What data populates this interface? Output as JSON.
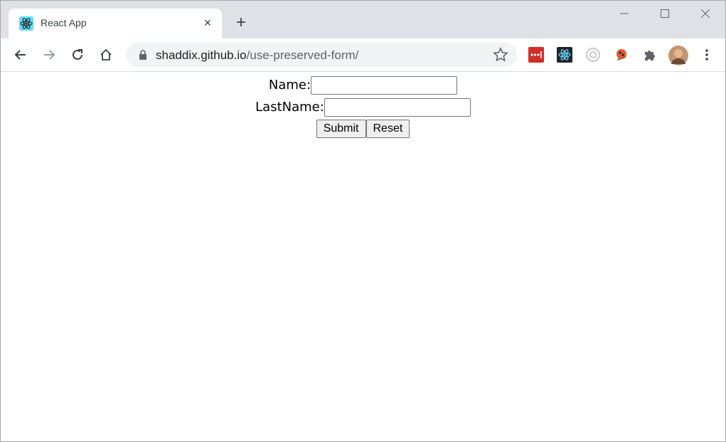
{
  "browser": {
    "tab": {
      "title": "React App",
      "close_label": "×"
    },
    "new_tab_label": "+",
    "window_controls": {
      "minimize": "—",
      "maximize": "☐",
      "close": "✕"
    },
    "address": {
      "host": "shaddix.github.io",
      "path": "/use-preserved-form/"
    },
    "extensions": [
      "lastpass-icon",
      "react-devtools-icon",
      "extension-circle-icon",
      "extension-ladybug-icon",
      "extensions-puzzle-icon",
      "profile-avatar",
      "more-menu-icon"
    ],
    "colors": {
      "tabstrip": "#dee1e6",
      "lastpass": "#d32d27",
      "react": "#61dafb"
    }
  },
  "form": {
    "name_label": "Name:",
    "name_value": "",
    "lastname_label": "LastName:",
    "lastname_value": "",
    "submit_label": "Submit",
    "reset_label": "Reset"
  }
}
